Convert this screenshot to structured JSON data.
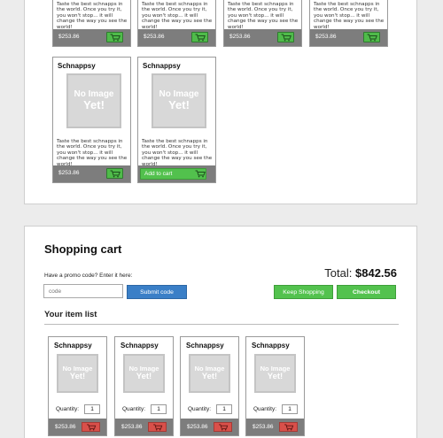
{
  "product_desc": "Taste the best schnapps in the world. Once you try it, you won't stop... it will change the way you see the world!",
  "catalog": {
    "top_row": [
      {
        "price": "$253.86"
      },
      {
        "price": "$253.86"
      },
      {
        "price": "$253.86"
      },
      {
        "price": "$253.86"
      }
    ],
    "second_row": [
      {
        "name": "Schnappsy",
        "image_text_1": "No Image",
        "image_text_2": "Yet!",
        "price": "$253.86"
      },
      {
        "name": "Schnappsy",
        "image_text_1": "No Image",
        "image_text_2": "Yet!",
        "add_label": "Add to cart"
      }
    ]
  },
  "cart": {
    "title": "Shopping cart",
    "promo_label": "Have a promo code? Enter it here:",
    "promo_placeholder": "code",
    "submit_label": "Submit code",
    "total_label": "Total:",
    "total_value": "$842.56",
    "keep_shopping_label": "Keep Shopping",
    "checkout_label": "Checkout",
    "items_heading": "Your item list",
    "items": [
      {
        "name": "Schnappsy",
        "image_text_1": "No Image",
        "image_text_2": "Yet!",
        "quantity_label": "Quantity:",
        "quantity": "1",
        "price": "$253.86"
      },
      {
        "name": "Schnappsy",
        "image_text_1": "No Image",
        "image_text_2": "Yet!",
        "quantity_label": "Quantity:",
        "quantity": "1",
        "price": "$253.86"
      },
      {
        "name": "Schnappsy",
        "image_text_1": "No Image",
        "image_text_2": "Yet!",
        "quantity_label": "Quantity:",
        "quantity": "1",
        "price": "$253.86"
      },
      {
        "name": "Schnappsy",
        "image_text_1": "No Image",
        "image_text_2": "Yet!",
        "quantity_label": "Quantity:",
        "quantity": "1",
        "price": "$253.86"
      }
    ]
  },
  "colors": {
    "accent_green": "#4fbb4a",
    "accent_blue": "#3a7fc7",
    "remove_red": "#d9504a",
    "price_bar": "#7d7d7d"
  },
  "icons": {
    "cart": "cart-icon"
  }
}
